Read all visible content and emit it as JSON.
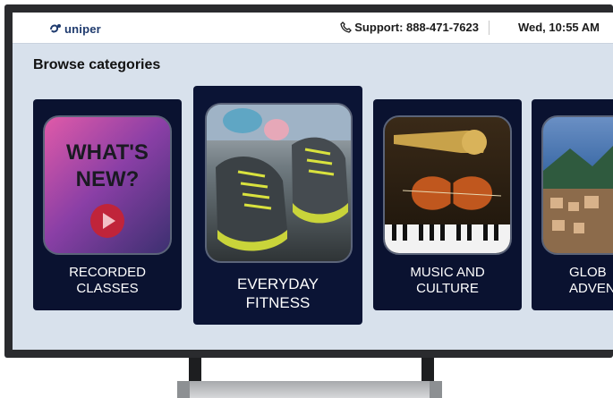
{
  "header": {
    "logo_text": "uniper",
    "support_text": "Support: 888-471-7623",
    "datetime": "Wed, 10:55 AM",
    "phone_icon": "phone-icon",
    "logo_icon": "uniper-logo-icon"
  },
  "page": {
    "heading": "Browse categories"
  },
  "categories": [
    {
      "label_line1": "RECORDED",
      "label_line2": "CLASSES",
      "thumb_text_line1": "WHAT'S",
      "thumb_text_line2": "NEW?",
      "thumb_icon": "play-icon"
    },
    {
      "label_line1": "EVERYDAY",
      "label_line2": "FITNESS",
      "thumb_icon": "sneakers-image"
    },
    {
      "label_line1": "MUSIC AND",
      "label_line2": "CULTURE",
      "thumb_icon": "violin-saxophone-image"
    },
    {
      "label_line1": "GLOB",
      "label_line2": "ADVENT",
      "thumb_icon": "coastal-town-image"
    }
  ],
  "colors": {
    "card_bg": "#0a1230",
    "screen_bg": "#d8e1ec",
    "brand": "#1f3b6e"
  }
}
